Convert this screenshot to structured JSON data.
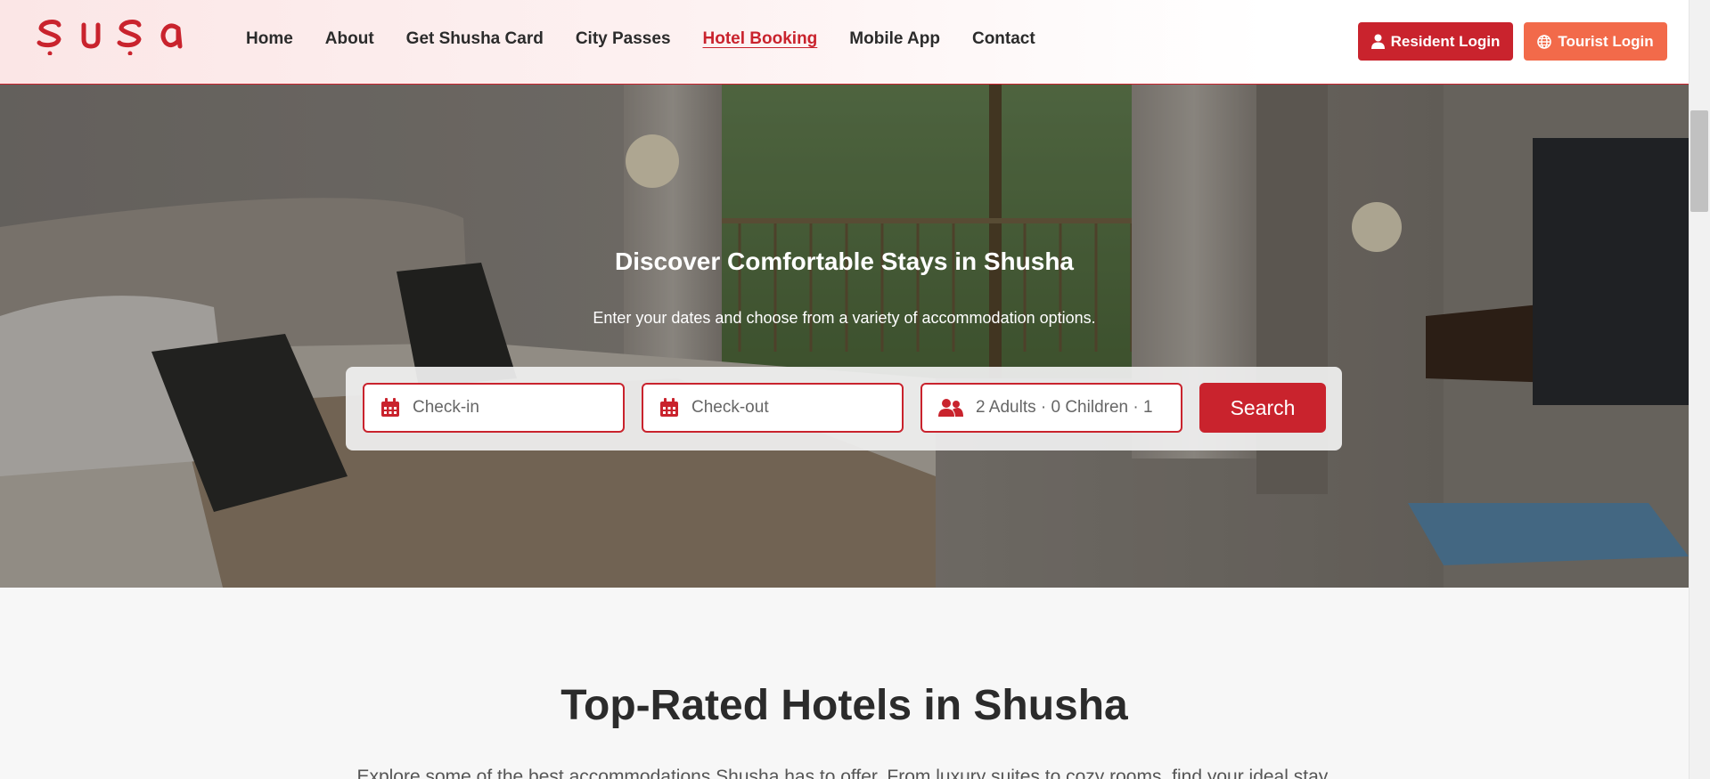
{
  "header": {
    "logo_text": "Şuşa",
    "nav": [
      {
        "label": "Home",
        "active": false
      },
      {
        "label": "About",
        "active": false
      },
      {
        "label": "Get Shusha Card",
        "active": false
      },
      {
        "label": "City Passes",
        "active": false
      },
      {
        "label": "Hotel Booking",
        "active": true
      },
      {
        "label": "Mobile App",
        "active": false
      },
      {
        "label": "Contact",
        "active": false
      }
    ],
    "resident_login": "Resident Login",
    "tourist_login": "Tourist Login"
  },
  "hero": {
    "title": "Discover Comfortable Stays in Shusha",
    "subtitle": "Enter your dates and choose from a variety of accommodation options.",
    "checkin_placeholder": "Check-in",
    "checkout_placeholder": "Check-out",
    "guests_value": "2 Adults · 0 Children · 1",
    "search_label": "Search"
  },
  "section": {
    "title": "Top-Rated Hotels in Shusha",
    "description": "Explore some of the best accommodations Shusha has to offer. From luxury suites to cozy rooms, find your ideal stay."
  },
  "colors": {
    "brand_red": "#c9232d",
    "tourist_orange": "#f26a4a"
  },
  "icons": {
    "resident": "user-icon",
    "tourist": "globe-icon",
    "checkin": "calendar-icon",
    "checkout": "calendar-icon",
    "guests": "users-icon"
  }
}
